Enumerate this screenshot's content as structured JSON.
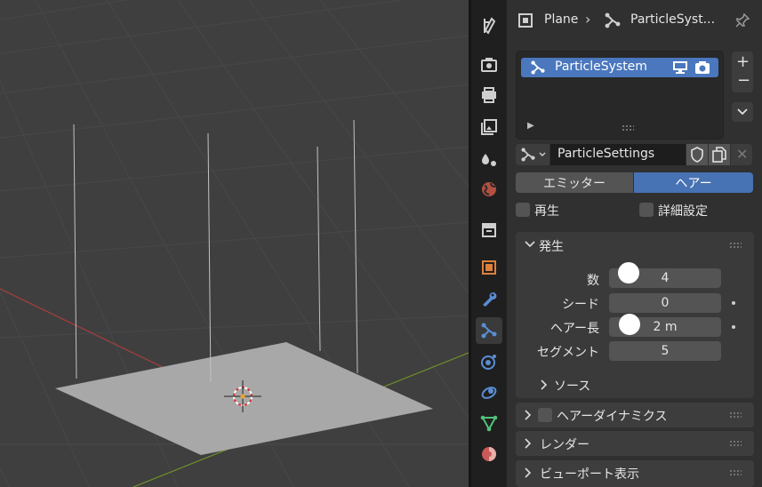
{
  "header": {
    "object_name": "Plane",
    "particle_system_name": "ParticleSyst..."
  },
  "particle_list": {
    "items": [
      {
        "label": "ParticleSystem",
        "selected": true
      }
    ]
  },
  "settings": {
    "datablock_name": "ParticleSettings"
  },
  "type_toggle": {
    "options": [
      "エミッター",
      "ヘアー"
    ],
    "active": "ヘアー"
  },
  "checkboxes": {
    "regrow_label": "再生",
    "advanced_label": "詳細設定"
  },
  "emission_panel": {
    "title": "発生",
    "fields": [
      {
        "label": "数",
        "value": "4"
      },
      {
        "label": "シード",
        "value": "0"
      },
      {
        "label": "ヘアー長",
        "value": "2 m"
      },
      {
        "label": "セグメント",
        "value": "5"
      }
    ],
    "source_subpanel": "ソース"
  },
  "collapsed_panels": {
    "hair_dynamics": "ヘアーダイナミクス",
    "render": "レンダー",
    "viewport_display": "ビューポート表示"
  },
  "colors": {
    "accent": "#4772b3",
    "selected_item": "#4a77bd",
    "x_axis": "#9e3f3f",
    "y_axis": "#6b8a2b"
  }
}
